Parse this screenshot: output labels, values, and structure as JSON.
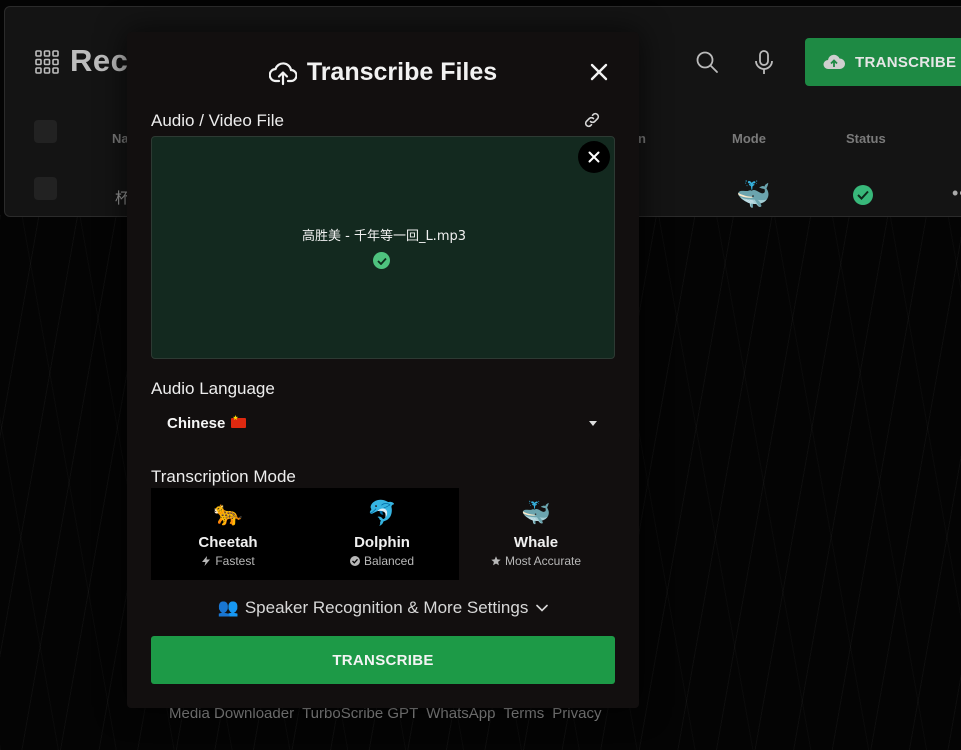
{
  "background": {
    "page_title": "Rece",
    "transcribe_button_label": "TRANSCRIBE FIL",
    "table": {
      "headers": [
        "Na",
        "n",
        "Mode",
        "Status"
      ],
      "row": {
        "name": "杯",
        "mode_emoji": "🐳"
      }
    },
    "more_label": "••"
  },
  "modal": {
    "title": "Transcribe Files",
    "file_section_label": "Audio / Video File",
    "file_name": "高胜美 - 千年等一回_L.mp3",
    "language_label": "Audio Language",
    "language_value": "Chinese",
    "mode_label": "Transcription Mode",
    "modes": [
      {
        "emoji": "🐆",
        "name": "Cheetah",
        "subtitle": "Fastest"
      },
      {
        "emoji": "🐬",
        "name": "Dolphin",
        "subtitle": "Balanced"
      },
      {
        "emoji": "🐳",
        "name": "Whale",
        "subtitle": "Most Accurate"
      }
    ],
    "settings_emoji": "👥",
    "settings_label": "Speaker Recognition & More Settings",
    "submit_label": "TRANSCRIBE"
  },
  "footer": {
    "links": [
      "Media Downloader",
      "TurboScribe GPT",
      "WhatsApp",
      "Terms",
      "Privacy"
    ]
  },
  "colors": {
    "accent_green": "#1d9a47",
    "dropzone_bg": "#13291f",
    "modal_bg": "#120f0f",
    "success_check": "#4ec27e"
  }
}
